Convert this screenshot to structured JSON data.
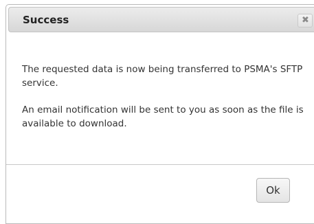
{
  "dialog": {
    "title": "Success",
    "close_icon": "close-icon",
    "close_glyph": "✖",
    "message_line_1": "The requested data is now being transferred to PSMA's SFTP service.",
    "message_line_2": "An email notification will be sent to you as soon as the file is available to download.",
    "ok_label": "Ok"
  }
}
